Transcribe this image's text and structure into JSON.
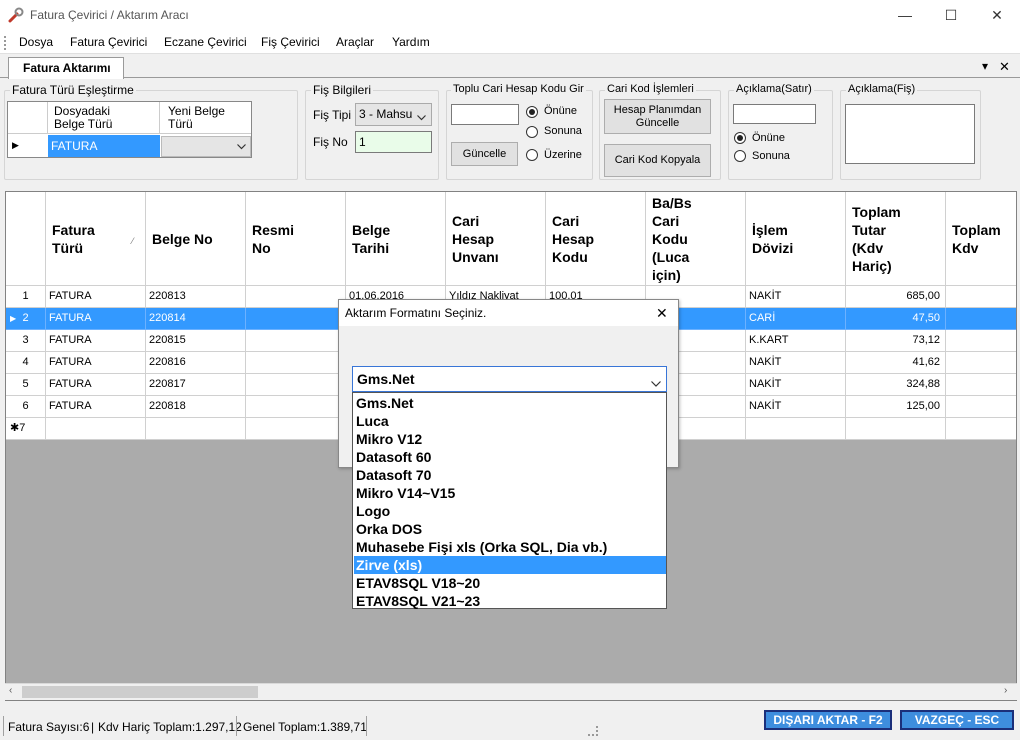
{
  "window": {
    "title": "Fatura Çevirici / Aktarım Aracı",
    "minimize": "—",
    "maximize": "☐",
    "close": "✕"
  },
  "menu": [
    "Dosya",
    "Fatura Çevirici",
    "Eczane Çevirici",
    "Fiş Çevirici",
    "Araçlar",
    "Yardım"
  ],
  "tab": {
    "label": "Fatura Aktarımı",
    "dropdown_glyph": "▾",
    "close_glyph": "✕"
  },
  "eslestirme": {
    "title": "Fatura Türü Eşleştirme",
    "col1": [
      "Dosyadaki",
      "Belge Türü"
    ],
    "col2": [
      "Yeni Belge",
      "Türü"
    ],
    "row_indicator": "▶",
    "value": "FATURA",
    "new_value": ""
  },
  "fis_bilgileri": {
    "title": "Fiş Bilgileri",
    "tipi_label": "Fiş Tipi",
    "tipi_value": "3 - Mahsu",
    "no_label": "Fiş No",
    "no_value": "1"
  },
  "toplu_cari": {
    "title": "Toplu Cari Hesap Kodu Gir",
    "input_value": "",
    "options": [
      "Önüne",
      "Sonuna",
      "Üzerine"
    ],
    "selected": 0,
    "button": "Güncelle"
  },
  "cari_kod": {
    "title": "Cari Kod İşlemleri",
    "btn1": [
      "Hesap Planımdan",
      "Güncelle"
    ],
    "btn2": "Cari Kod Kopyala"
  },
  "aciklama_satir": {
    "title": "Açıklama(Satır)",
    "input_value": "",
    "options": [
      "Önüne",
      "Sonuna"
    ],
    "selected": 0
  },
  "aciklama_fis": {
    "title": "Açıklama(Fiş)",
    "value": ""
  },
  "grid": {
    "columns": [
      [
        "Fatura",
        "Türü"
      ],
      [
        "Belge No"
      ],
      [
        "Resmi",
        "No"
      ],
      [
        "Belge",
        "Tarihi"
      ],
      [
        "Cari",
        "Hesap",
        "Unvanı"
      ],
      [
        "Cari",
        "Hesap",
        "Kodu"
      ],
      [
        "Ba/Bs",
        "Cari",
        "Kodu",
        "(Luca",
        "için)"
      ],
      [
        "İşlem",
        "Dövizi"
      ],
      [
        "Toplam",
        "Tutar",
        "(Kdv",
        "Hariç)"
      ],
      [
        "Toplam",
        "Kdv"
      ]
    ],
    "sort_glyph": "⁄",
    "rows": [
      {
        "n": "1",
        "tur": "FATURA",
        "belge": "220813",
        "resmi": "",
        "tarih": "01.06.2016",
        "unvan": "Yıldız Nakliyat",
        "kod": "100.01",
        "babs": "",
        "doviz": "NAKİT",
        "tutar": "685,00"
      },
      {
        "n": "2",
        "tur": "FATURA",
        "belge": "220814",
        "resmi": "",
        "tarih": "",
        "unvan": "",
        "kod": "",
        "babs": "",
        "doviz": "CARİ",
        "tutar": "47,50"
      },
      {
        "n": "3",
        "tur": "FATURA",
        "belge": "220815",
        "resmi": "",
        "tarih": "",
        "unvan": "",
        "kod": "",
        "babs": "",
        "doviz": "K.KART",
        "tutar": "73,12"
      },
      {
        "n": "4",
        "tur": "FATURA",
        "belge": "220816",
        "resmi": "",
        "tarih": "",
        "unvan": "",
        "kod": "",
        "babs": "",
        "doviz": "NAKİT",
        "tutar": "41,62"
      },
      {
        "n": "5",
        "tur": "FATURA",
        "belge": "220817",
        "resmi": "",
        "tarih": "",
        "unvan": "",
        "kod": "",
        "babs": "",
        "doviz": "NAKİT",
        "tutar": "324,88"
      },
      {
        "n": "6",
        "tur": "FATURA",
        "belge": "220818",
        "resmi": "",
        "tarih": "",
        "unvan": "",
        "kod": "",
        "babs": "",
        "doviz": "NAKİT",
        "tutar": "125,00"
      }
    ],
    "new_row": "✱7",
    "selected_row": 1
  },
  "status": {
    "sayi": "Fatura Sayısı:6",
    "kdv_haric": "Kdv Hariç Toplam:1.297,12",
    "genel": "Genel Toplam:1.389,71"
  },
  "buttons": {
    "aktar": "DIŞARI AKTAR - F2",
    "vazgec": "VAZGEÇ - ESC"
  },
  "dialog": {
    "title": "Aktarım Formatını Seçiniz.",
    "selected": "Gms.Net",
    "options": [
      "Gms.Net",
      "Luca",
      "Mikro V12",
      "Datasoft 60",
      "Datasoft 70",
      "Mikro V14~V15",
      "Logo",
      "Orka DOS",
      "Muhasebe Fişi xls (Orka SQL, Dia vb.)",
      "Zirve (xls)",
      "ETAV8SQL V18~20",
      "ETAV8SQL V21~23"
    ],
    "highlighted": 9
  },
  "colors": {
    "selection": "#3399ff",
    "action_button": "#3e8ede",
    "action_border": "#1b2f7a"
  }
}
